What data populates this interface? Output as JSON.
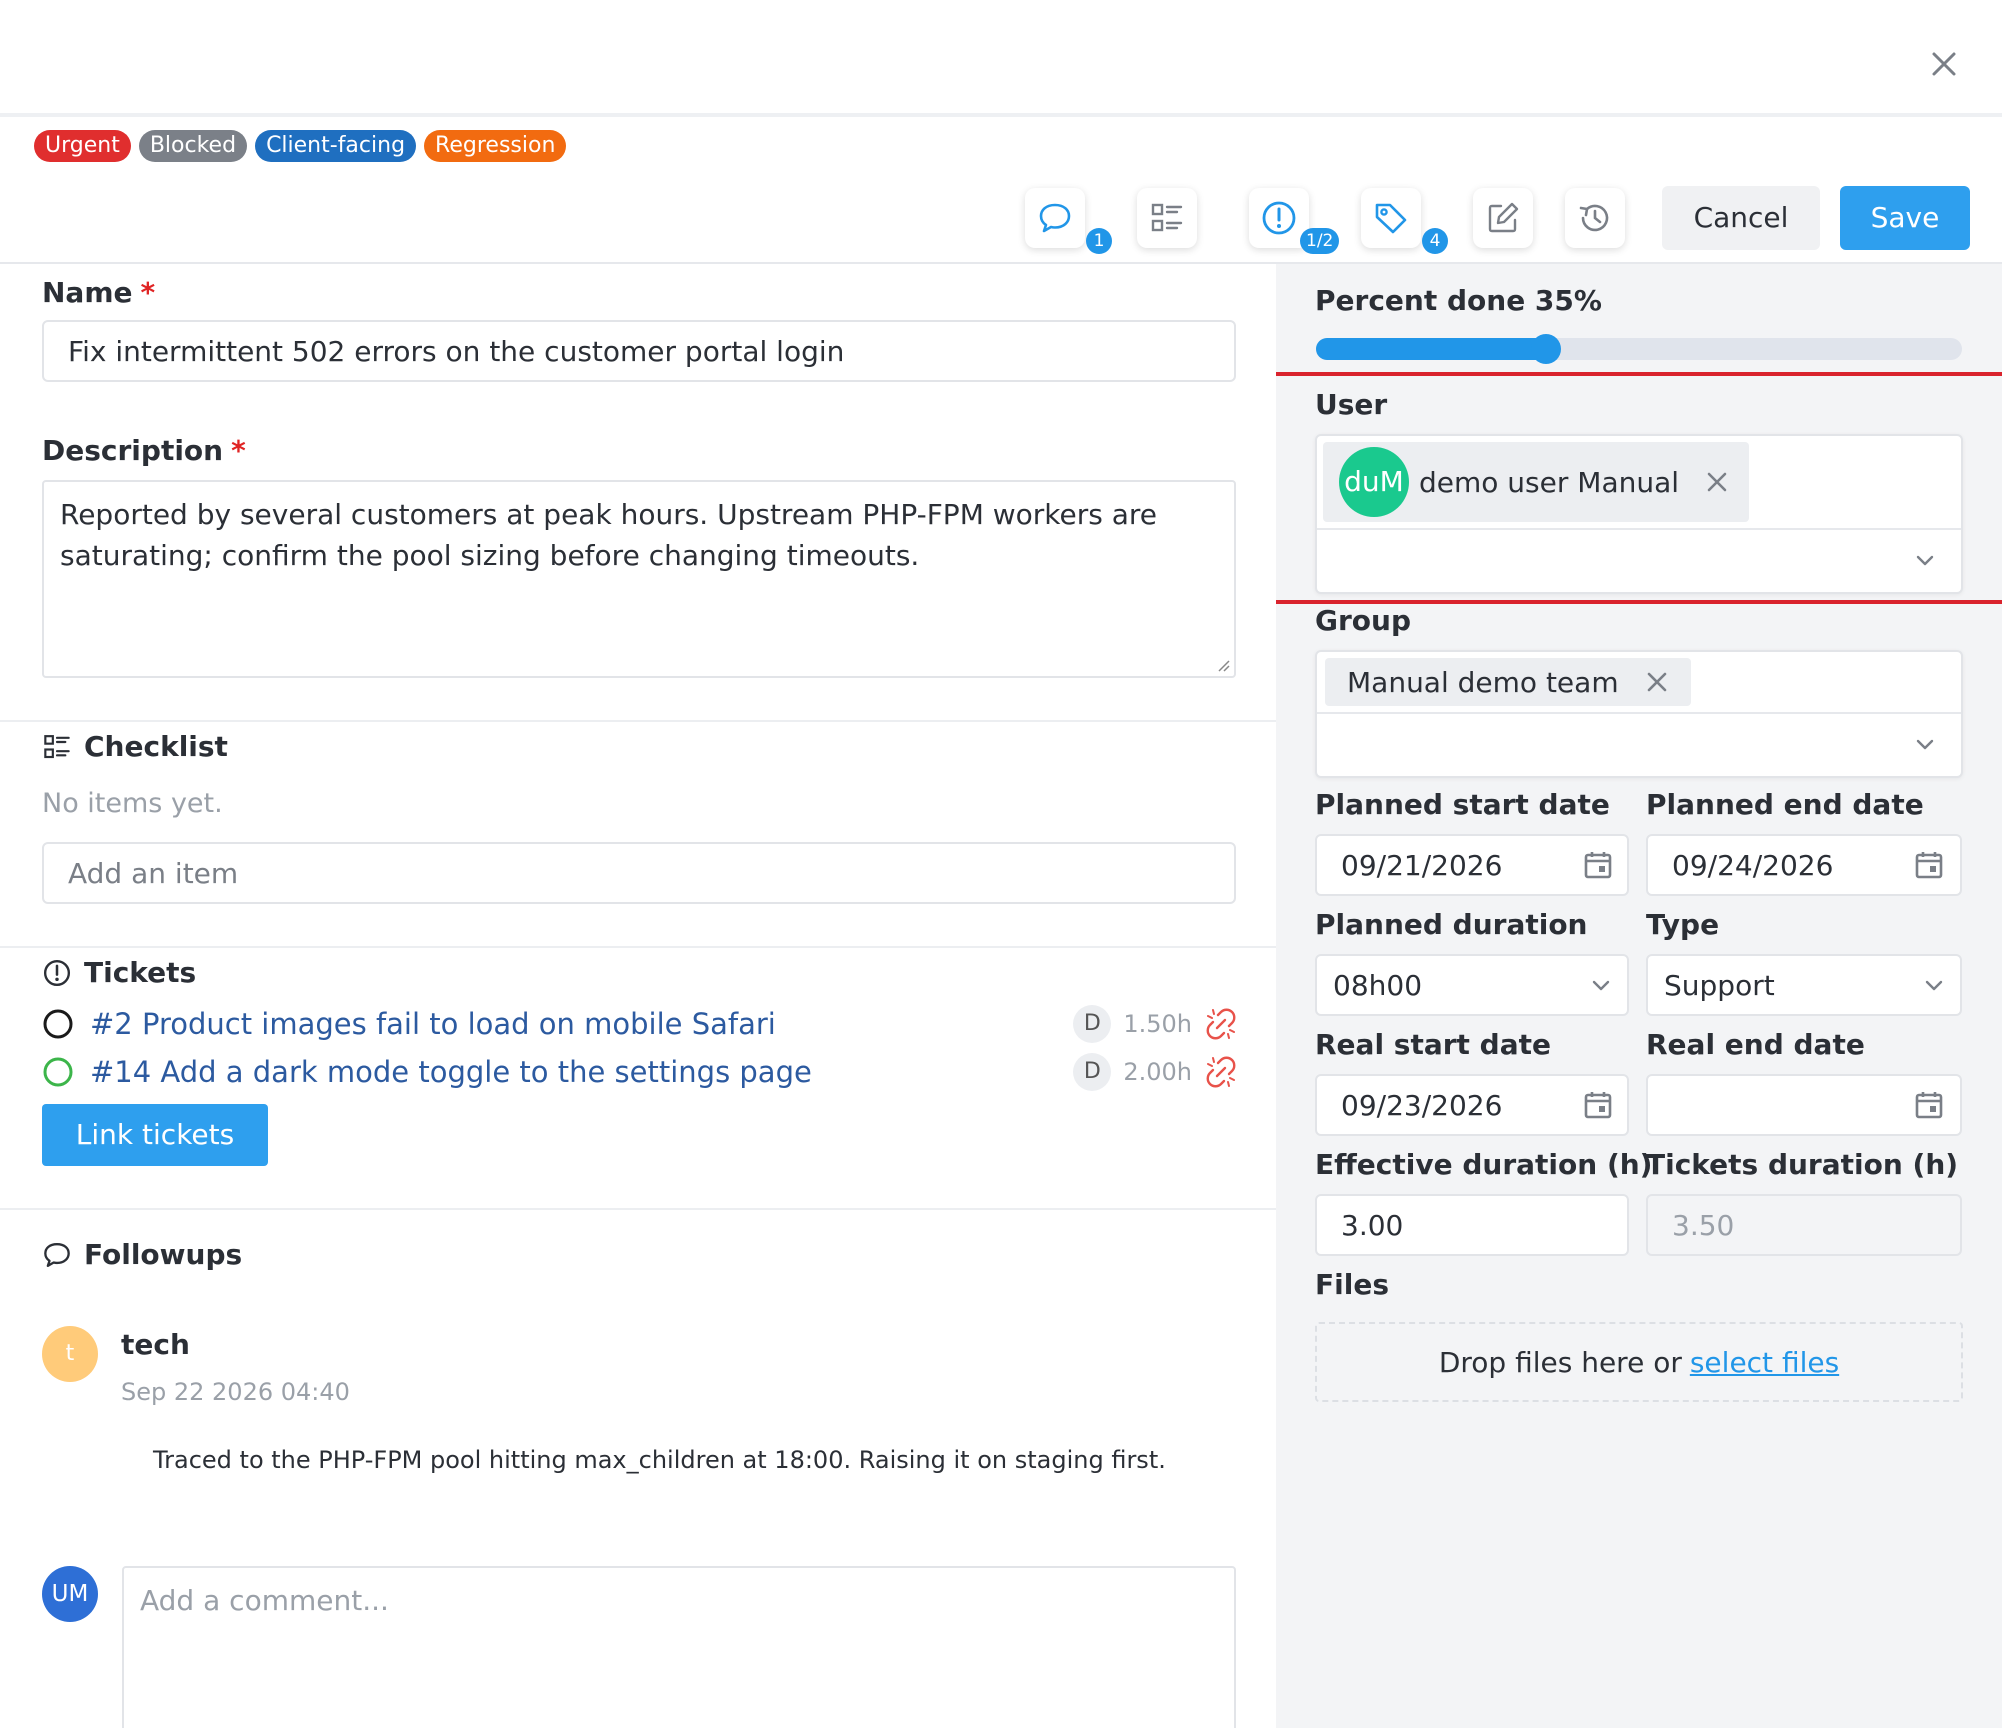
{
  "tags": [
    {
      "label": "Urgent",
      "color": "#e02e2e"
    },
    {
      "label": "Blocked",
      "color": "#7b8088"
    },
    {
      "label": "Client-facing",
      "color": "#1f6fc0"
    },
    {
      "label": "Regression",
      "color": "#f26b10"
    }
  ],
  "toolbar": {
    "followups_count": "1",
    "tickets_badge": "1/2",
    "tags_count": "4",
    "cancel_label": "Cancel",
    "save_label": "Save"
  },
  "form": {
    "name_label": "Name",
    "required_mark": "*",
    "name_value": "Fix intermittent 502 errors on the customer portal login",
    "description_label": "Description",
    "description_value": "Reported by several customers at peak hours. Upstream PHP-FPM workers are saturating; confirm the pool sizing before changing timeouts."
  },
  "checklist": {
    "title": "Checklist",
    "empty_text": "No items yet.",
    "input_placeholder": "Add an item"
  },
  "tickets": {
    "title": "Tickets",
    "items": [
      {
        "label": "#2 Product images fail to load on mobile Safari",
        "initial": "D",
        "hours": "1.50h",
        "status_color": "#1a1a1a"
      },
      {
        "label": "#14 Add a dark mode toggle to the settings page",
        "initial": "D",
        "hours": "2.00h",
        "status_color": "#3cb54a"
      }
    ],
    "link_button": "Link tickets"
  },
  "followups": {
    "title": "Followups",
    "author": "tech",
    "author_initial": "t",
    "date": "Sep 22 2026 04:40",
    "content": "Traced to the PHP-FPM pool hitting max_children at 18:00. Raising it on staging first.",
    "me_initials": "UM",
    "comment_placeholder": "Add a comment..."
  },
  "side": {
    "percent_label": "Percent done 35%",
    "percent_value": 0.35,
    "user_label": "User",
    "user_initials": "duM",
    "user_name": "demo user Manual",
    "group_label": "Group",
    "group_name": "Manual demo team",
    "planned_start_label": "Planned start date",
    "planned_start_value": "09/21/2026",
    "planned_end_label": "Planned end date",
    "planned_end_value": "09/24/2026",
    "planned_duration_label": "Planned duration",
    "planned_duration_value": "08h00",
    "type_label": "Type",
    "type_value": "Support",
    "real_start_label": "Real start date",
    "real_start_value": "09/23/2026",
    "real_end_label": "Real end date",
    "real_end_value": "",
    "effective_label": "Effective duration (h)",
    "effective_value": "3.00",
    "tickets_duration_label": "Tickets duration (h)",
    "tickets_duration_value": "3.50",
    "files_label": "Files",
    "drop_text": "Drop files here or",
    "select_files": "select files"
  }
}
